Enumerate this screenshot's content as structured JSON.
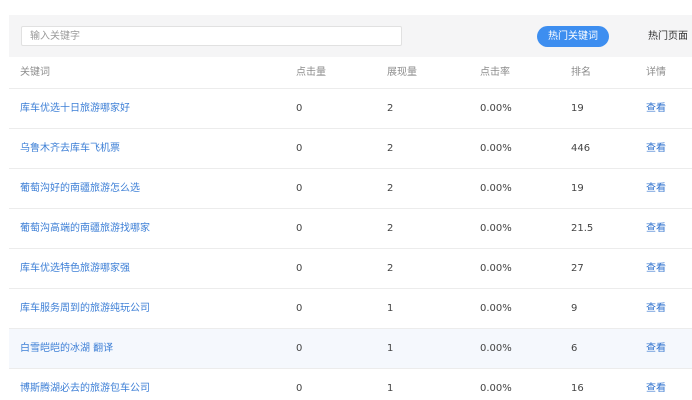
{
  "search": {
    "placeholder": "输入关键字"
  },
  "toolbar": {
    "hot_keyword_label": "热门关键词",
    "hot_page_label": "热门页面"
  },
  "table": {
    "headers": {
      "keyword": "关键词",
      "clicks": "点击量",
      "impressions": "展现量",
      "ctr": "点击率",
      "rank": "排名",
      "detail": "详情"
    },
    "rows": [
      {
        "keyword": "库车优选十日旅游哪家好",
        "clicks": "0",
        "impressions": "2",
        "ctr": "0.00%",
        "rank": "19",
        "action": "查看"
      },
      {
        "keyword": "乌鲁木齐去库车飞机票",
        "clicks": "0",
        "impressions": "2",
        "ctr": "0.00%",
        "rank": "446",
        "action": "查看"
      },
      {
        "keyword": "葡萄沟好的南疆旅游怎么选",
        "clicks": "0",
        "impressions": "2",
        "ctr": "0.00%",
        "rank": "19",
        "action": "查看"
      },
      {
        "keyword": "葡萄沟高端的南疆旅游找哪家",
        "clicks": "0",
        "impressions": "2",
        "ctr": "0.00%",
        "rank": "21.5",
        "action": "查看"
      },
      {
        "keyword": "库车优选特色旅游哪家强",
        "clicks": "0",
        "impressions": "2",
        "ctr": "0.00%",
        "rank": "27",
        "action": "查看"
      },
      {
        "keyword": "库车服务周到的旅游纯玩公司",
        "clicks": "0",
        "impressions": "1",
        "ctr": "0.00%",
        "rank": "9",
        "action": "查看"
      },
      {
        "keyword": "白雪皑皑的冰湖 翻译",
        "clicks": "0",
        "impressions": "1",
        "ctr": "0.00%",
        "rank": "6",
        "action": "查看"
      },
      {
        "keyword": "博斯腾湖必去的旅游包车公司",
        "clicks": "0",
        "impressions": "1",
        "ctr": "0.00%",
        "rank": "16",
        "action": "查看"
      }
    ]
  },
  "colors": {
    "accent": "#3d8ef0",
    "link": "#3d7fd6",
    "header_text": "#8d8d8d",
    "highlight_row": "#f5f8fd"
  }
}
